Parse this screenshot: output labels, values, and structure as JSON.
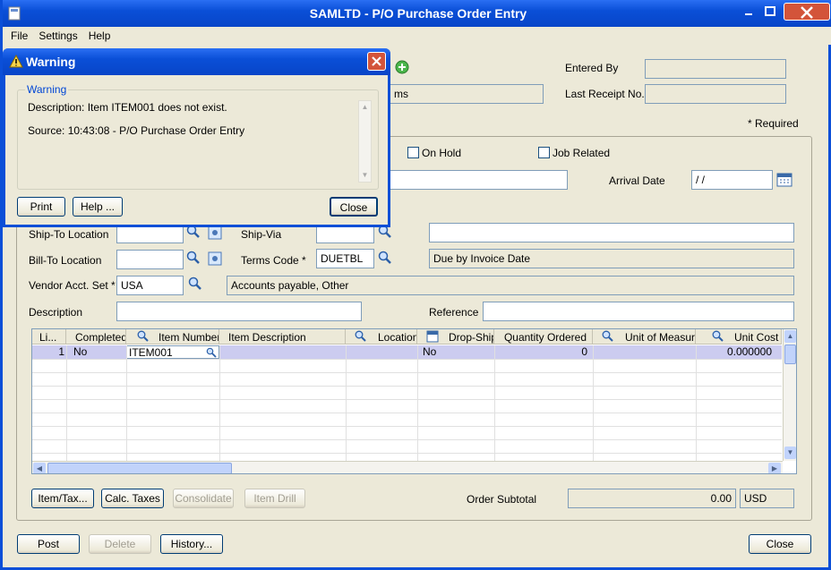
{
  "window": {
    "title": "SAMLTD - P/O Purchase Order Entry"
  },
  "menu": [
    "File",
    "Settings",
    "Help"
  ],
  "header": {
    "entered_by_label": "Entered By",
    "entered_by_value": "",
    "last_receipt_label": "Last Receipt No.",
    "last_receipt_value": "",
    "partial_field_text": "ms",
    "required_note": "* Required"
  },
  "form": {
    "on_hold_label": "On Hold",
    "job_related_label": "Job Related",
    "arrival_date_label": "Arrival Date",
    "arrival_date_value": "/  /",
    "ship_to_label": "Ship-To Location",
    "ship_via_label": "Ship-Via",
    "bill_to_label": "Bill-To Location",
    "terms_code_label": "Terms Code *",
    "terms_code_value": "DUETBL",
    "terms_desc": "Due by Invoice Date",
    "vendor_acct_label": "Vendor Acct. Set *",
    "vendor_acct_value": "USA",
    "vendor_acct_desc": "Accounts payable, Other",
    "description_label": "Description",
    "reference_label": "Reference"
  },
  "grid": {
    "columns": [
      "Li...",
      "Completed",
      "Item Number",
      "Item Description",
      "Location",
      "Drop-Ship",
      "Quantity Ordered",
      "Unit of Measure",
      "Unit Cost"
    ],
    "rows": [
      [
        "1",
        "No",
        "ITEM001",
        "",
        "",
        "No",
        "0",
        "",
        "0.000000"
      ]
    ]
  },
  "bottom": {
    "item_tax_button": "Item/Tax...",
    "calc_taxes_button": "Calc. Taxes",
    "consolidate_button": "Consolidate",
    "item_drill_button": "Item Drill",
    "order_subtotal_label": "Order Subtotal",
    "order_subtotal_value": "0.00",
    "currency": "USD",
    "post_button": "Post",
    "delete_button": "Delete",
    "history_button": "History...",
    "close_button": "Close"
  },
  "dialog": {
    "title": "Warning",
    "group_label": "Warning",
    "description": "Description: Item ITEM001 does not exist.",
    "source": "Source:  10:43:08 - P/O Purchase Order Entry",
    "print_button": "Print",
    "help_button": "Help ...",
    "close_button": "Close"
  },
  "colors": {
    "titlebar": "#0a4fd7",
    "window_bg": "#ece9d8",
    "selected_row": "#ccccf0",
    "group_label": "#0046d5"
  }
}
